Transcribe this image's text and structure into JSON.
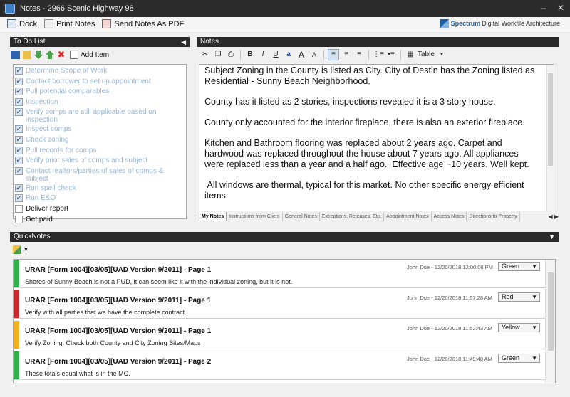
{
  "window": {
    "title": "Notes - 2966 Scenic Highway 98",
    "minimize_icon": "minimize-icon",
    "close_icon": "close-icon"
  },
  "toolbar": {
    "dock_label": "Dock",
    "print_label": "Print Notes",
    "send_label": "Send Notes As PDF",
    "brand_strong": "Spectrum",
    "brand_rest": "Digital Workfile Architecture"
  },
  "todo": {
    "header": "To Do List",
    "add_label": "Add Item",
    "items": [
      {
        "label": "Determine Scope of Work",
        "done": true
      },
      {
        "label": "Contact borrower to set up appointment",
        "done": true
      },
      {
        "label": "Pull potential comparables",
        "done": true
      },
      {
        "label": "Inspection",
        "done": true
      },
      {
        "label": "Verify comps are still applicable based on inspection",
        "done": true
      },
      {
        "label": "Inspect comps",
        "done": true
      },
      {
        "label": "Check zoning",
        "done": true
      },
      {
        "label": "Pull records for comps",
        "done": true
      },
      {
        "label": "Verify prior sales of comps and subject",
        "done": true
      },
      {
        "label": "Contact realtors/parties of sales of comps & subject",
        "done": true
      },
      {
        "label": "Run spell check",
        "done": true
      },
      {
        "label": "Run E&O",
        "done": true
      },
      {
        "label": "Deliver report",
        "done": false
      },
      {
        "label": "Get paid",
        "done": false
      }
    ]
  },
  "notes": {
    "header": "Notes",
    "toolbar": {
      "bold": "B",
      "italic": "I",
      "underline": "U",
      "font_grow": "A",
      "font_shrink": "A",
      "table_label": "Table"
    },
    "paragraphs": [
      "Subject Zoning in the County is listed as City. City of Destin has the Zoning listed as Residential - Sunny Beach Neighborhood.",
      "County has it listed as 2 stories, inspections revealed it is a 3 story house.",
      "County only accounted for the interior fireplace, there is also an exterior fireplace.",
      "Kitchen and Bathroom flooring was replaced about 2 years ago. Carpet and hardwood was replaced throughout the house about 7 years ago. All appliances were replaced less than a year and a half ago.  Effective age ~10 years. Well kept.",
      " All windows are thermal, typical for this market. No other specific energy efficient items."
    ],
    "tabs": [
      "My Notes",
      "Instructions from Client",
      "General Notes",
      "Exceptions, Releases, Etc.",
      "Appointment Notes",
      "Access Notes",
      "Directions to Property"
    ]
  },
  "quicknotes": {
    "header": "QuickNotes",
    "items": [
      {
        "title": "URAR [Form 1004][03/05][UAD Version 9/2011] - Page 1",
        "text": "Shores of Sunny Beach is not a PUD, it can seem like it with the individual zoning, but it is not.",
        "meta": "John Doe - 12/20/2018 12:00:06 PM",
        "status": "Green",
        "color": "#2fb24a"
      },
      {
        "title": "URAR [Form 1004][03/05][UAD Version 9/2011] - Page 1",
        "text": "Verify with all parties that we have the complete contract.",
        "meta": "John Doe - 12/20/2018 11:57:28 AM",
        "status": "Red",
        "color": "#c8282a"
      },
      {
        "title": "URAR [Form 1004][03/05][UAD Version 9/2011] - Page 1",
        "text": "Verify Zoning, Check both County and City Zoning Sites/Maps",
        "meta": "John Doe - 12/20/2018 11:52:43 AM",
        "status": "Yellow",
        "color": "#f6b21c"
      },
      {
        "title": "URAR [Form 1004][03/05][UAD Version 9/2011] - Page 2",
        "text": "These totals equal what is in the MC.",
        "meta": "John Doe - 12/20/2018 11:49:48 AM",
        "status": "Green",
        "color": "#2fb24a"
      }
    ]
  }
}
